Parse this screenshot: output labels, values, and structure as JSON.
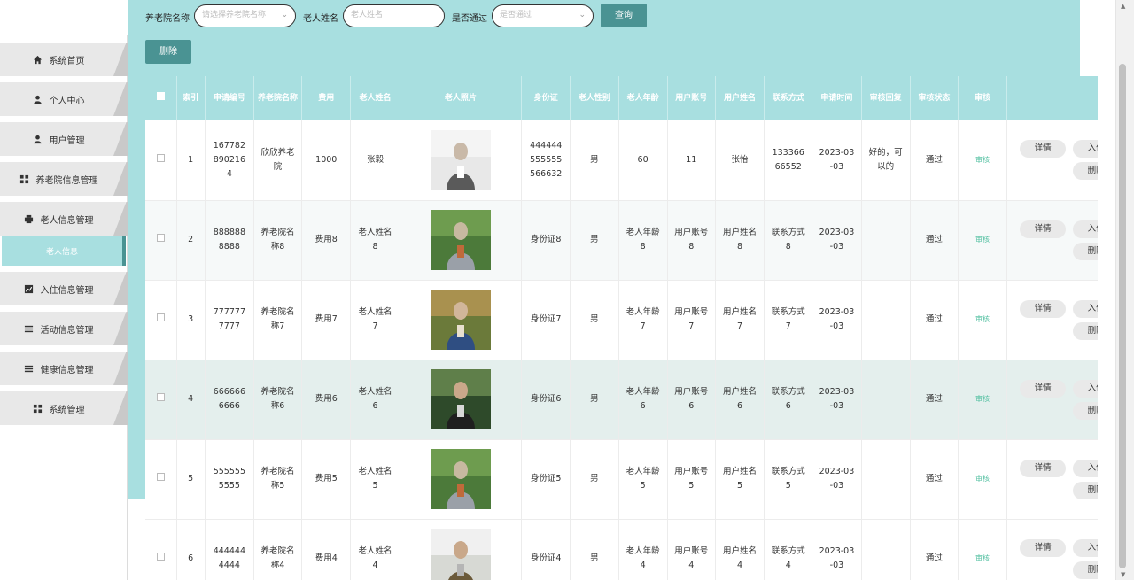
{
  "search": {
    "nursing_home_label": "养老院名称",
    "nursing_home_placeholder": "请选择养老院名称",
    "elder_name_label": "老人姓名",
    "elder_name_placeholder": "老人姓名",
    "approved_label": "是否通过",
    "approved_placeholder": "是否通过",
    "query_button": "查询"
  },
  "toolbar": {
    "delete_button": "删除"
  },
  "sidebar": {
    "items": [
      {
        "label": "系统首页",
        "icon": "home-icon"
      },
      {
        "label": "个人中心",
        "icon": "user-icon"
      },
      {
        "label": "用户管理",
        "icon": "user-icon"
      },
      {
        "label": "养老院信息管理",
        "icon": "grid-icon"
      },
      {
        "label": "老人信息管理",
        "icon": "printer-icon"
      },
      {
        "label": "入住信息管理",
        "icon": "chart-icon"
      },
      {
        "label": "活动信息管理",
        "icon": "list-icon"
      },
      {
        "label": "健康信息管理",
        "icon": "list-icon"
      },
      {
        "label": "系统管理",
        "icon": "grid-icon"
      }
    ],
    "active_sub": "老人信息"
  },
  "table": {
    "columns": [
      "",
      "索引",
      "申请编号",
      "养老院名称",
      "费用",
      "老人姓名",
      "老人照片",
      "身份证",
      "老人性别",
      "老人年龄",
      "用户账号",
      "用户姓名",
      "联系方式",
      "申请时间",
      "审核回复",
      "审核状态",
      "审核",
      "操作"
    ],
    "rows": [
      {
        "idx": "1",
        "app_no": "1677828902164",
        "home": "欣欣养老院",
        "fee": "1000",
        "name": "张毅",
        "id_card": "444444555555566632",
        "gender": "男",
        "age": "60",
        "account": "11",
        "user_name": "张怡",
        "contact": "13336666552",
        "apply_time": "2023-03-03",
        "reply": "好的，可以的",
        "status": "通过",
        "audit": "审核"
      },
      {
        "idx": "2",
        "app_no": "8888888888",
        "home": "养老院名称8",
        "fee": "费用8",
        "name": "老人姓名8",
        "id_card": "身份证8",
        "gender": "男",
        "age": "老人年龄8",
        "account": "用户账号8",
        "user_name": "用户姓名8",
        "contact": "联系方式8",
        "apply_time": "2023-03-03",
        "reply": "",
        "status": "通过",
        "audit": "审核"
      },
      {
        "idx": "3",
        "app_no": "7777777777",
        "home": "养老院名称7",
        "fee": "费用7",
        "name": "老人姓名7",
        "id_card": "身份证7",
        "gender": "男",
        "age": "老人年龄7",
        "account": "用户账号7",
        "user_name": "用户姓名7",
        "contact": "联系方式7",
        "apply_time": "2023-03-03",
        "reply": "",
        "status": "通过",
        "audit": "审核"
      },
      {
        "idx": "4",
        "app_no": "6666666666",
        "home": "养老院名称6",
        "fee": "费用6",
        "name": "老人姓名6",
        "id_card": "身份证6",
        "gender": "男",
        "age": "老人年龄6",
        "account": "用户账号6",
        "user_name": "用户姓名6",
        "contact": "联系方式6",
        "apply_time": "2023-03-03",
        "reply": "",
        "status": "通过",
        "audit": "审核"
      },
      {
        "idx": "5",
        "app_no": "5555555555",
        "home": "养老院名称5",
        "fee": "费用5",
        "name": "老人姓名5",
        "id_card": "身份证5",
        "gender": "男",
        "age": "老人年龄5",
        "account": "用户账号5",
        "user_name": "用户姓名5",
        "contact": "联系方式5",
        "apply_time": "2023-03-03",
        "reply": "",
        "status": "通过",
        "audit": "审核"
      },
      {
        "idx": "6",
        "app_no": "4444444444",
        "home": "养老院名称4",
        "fee": "费用4",
        "name": "老人姓名4",
        "id_card": "身份证4",
        "gender": "男",
        "age": "老人年龄4",
        "account": "用户账号4",
        "user_name": "用户姓名4",
        "contact": "联系方式4",
        "apply_time": "2023-03-03",
        "reply": "",
        "status": "通过",
        "audit": "审核"
      }
    ],
    "action_labels": {
      "detail": "详情",
      "checkin": "入住",
      "delete": "删除"
    }
  },
  "colors": {
    "teal_light": "#a8dfe0",
    "teal_dark": "#4a9393",
    "audit_green": "#4fbf9f"
  }
}
